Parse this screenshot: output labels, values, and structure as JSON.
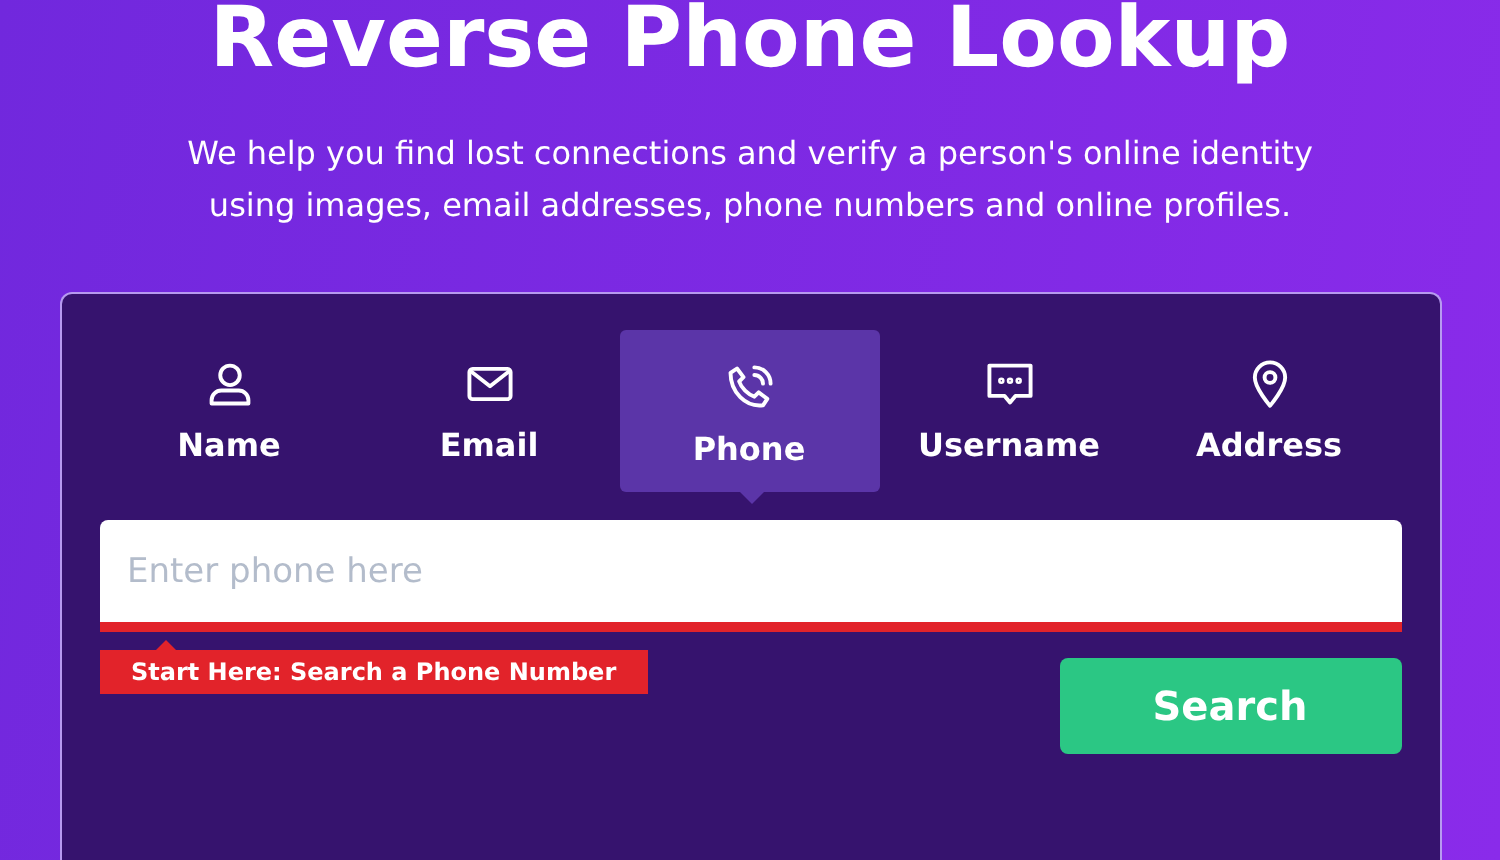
{
  "title": "Reverse Phone Lookup",
  "intro": "We help you find lost connections and verify a person's online identity using images, email addresses, phone numbers and online profiles.",
  "tabs": [
    {
      "label": "Name",
      "kind": "person",
      "selected": false
    },
    {
      "label": "Email",
      "kind": "envelope",
      "selected": false
    },
    {
      "label": "Phone",
      "kind": "phone",
      "selected": true
    },
    {
      "label": "Username",
      "kind": "chat",
      "selected": false
    },
    {
      "label": "Address",
      "kind": "pin",
      "selected": false
    }
  ],
  "search": {
    "placeholder": "Enter phone here",
    "hint": "Start Here: Search a Phone Number",
    "button": "Search"
  }
}
